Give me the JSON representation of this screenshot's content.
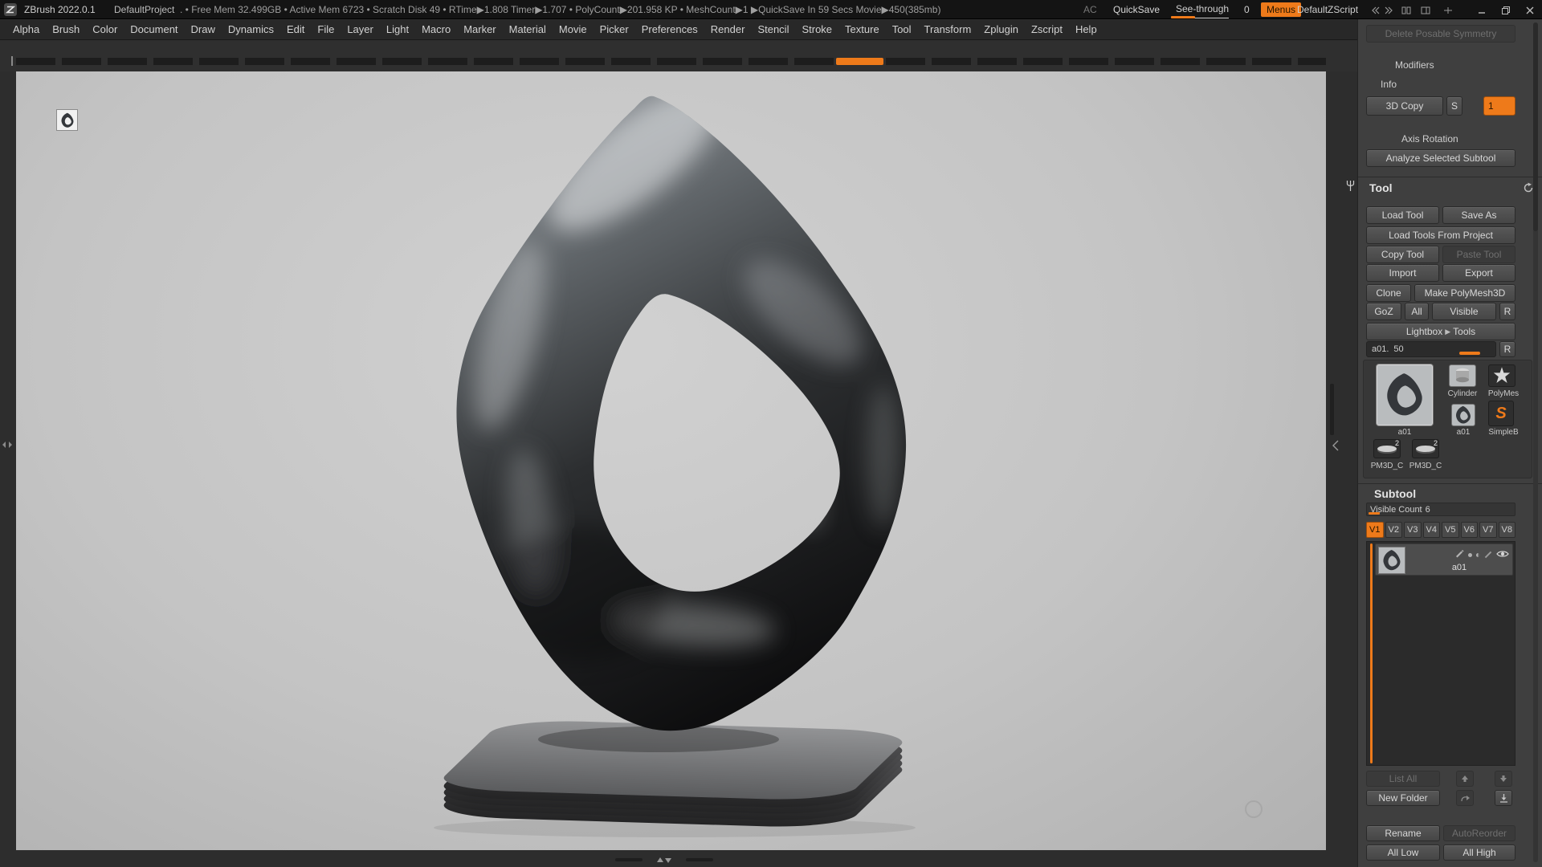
{
  "colors": {
    "accent_orange": "#ee7a1a",
    "titlebar_bg": "#141414",
    "menubar_bg": "#282828",
    "panel_bg": "#3f3f3f",
    "button_bg": "#4f4f4f",
    "canvas_bg": "#c6c6c6",
    "list_bg": "#2b2b2b",
    "selection_bg": "#4d4d4d"
  },
  "titlebar": {
    "app_title": "ZBrush 2022.0.1",
    "project_name": "DefaultProject",
    "stats": ". • Free Mem 32.499GB • Active Mem 6723 • Scratch Disk 49 • RTime▶1.808 Timer▶1.707 • PolyCount▶201.958 KP • MeshCount▶1 ▶QuickSave In 59 Secs Movie▶450(385mb)",
    "ac": "AC",
    "quicksave": "QuickSave",
    "see_through": "See-through",
    "see_through_value": "0",
    "menus": "Menus",
    "zscript": "DefaultZScript"
  },
  "menubar": {
    "items": [
      "Alpha",
      "Brush",
      "Color",
      "Document",
      "Draw",
      "Dynamics",
      "Edit",
      "File",
      "Layer",
      "Light",
      "Macro",
      "Marker",
      "Material",
      "Movie",
      "Picker",
      "Preferences",
      "Render",
      "Stencil",
      "Stroke",
      "Texture",
      "Tool",
      "Transform",
      "Zplugin",
      "Zscript",
      "Help"
    ]
  },
  "modifiers_panel": {
    "delete_posable_symmetry": "Delete Posable Symmetry",
    "modifiers_header": "Modifiers",
    "info_header": "Info",
    "copy_3d": "3D Copy",
    "s_button": "S",
    "copies_value": "1",
    "axis_rotation_header": "Axis Rotation",
    "analyze_selected_subtool": "Analyze Selected Subtool"
  },
  "tool_palette": {
    "header": "Tool",
    "load_tool": "Load Tool",
    "save_as": "Save As",
    "load_tools_from_project": "Load Tools From Project",
    "copy_tool": "Copy Tool",
    "paste_tool": "Paste Tool",
    "import": "Import",
    "export": "Export",
    "clone": "Clone",
    "make_polymesh3d": "Make PolyMesh3D",
    "goz": "GoZ",
    "all": "All",
    "visible": "Visible",
    "r": "R",
    "lightbox": "Lightbox",
    "lightbox_arrow": "▶",
    "tools": "Tools",
    "slider_label": "a01.",
    "slider_value": "50",
    "slider_r": "R",
    "thumbs": {
      "a01_big": "a01",
      "cylinder": "Cylinder",
      "polymesh": "PolyMes",
      "a01_small": "a01",
      "simplebrush": "SimpleB",
      "simplebrush_letter": "S",
      "pm3d_left": "PM3D_C",
      "pm3d_right": "PM3D_C",
      "pm3d_badge": "2"
    }
  },
  "subtool_palette": {
    "header": "Subtool",
    "visible_count_label": "Visible Count",
    "visible_count_value": "6",
    "tabs": [
      "V1",
      "V2",
      "V3",
      "V4",
      "V5",
      "V6",
      "V7",
      "V8"
    ],
    "item_name": "a01",
    "list_all": "List All",
    "new_folder": "New Folder",
    "rename": "Rename",
    "autoreorder": "AutoReorder",
    "all_low": "All Low",
    "all_high": "All High"
  }
}
